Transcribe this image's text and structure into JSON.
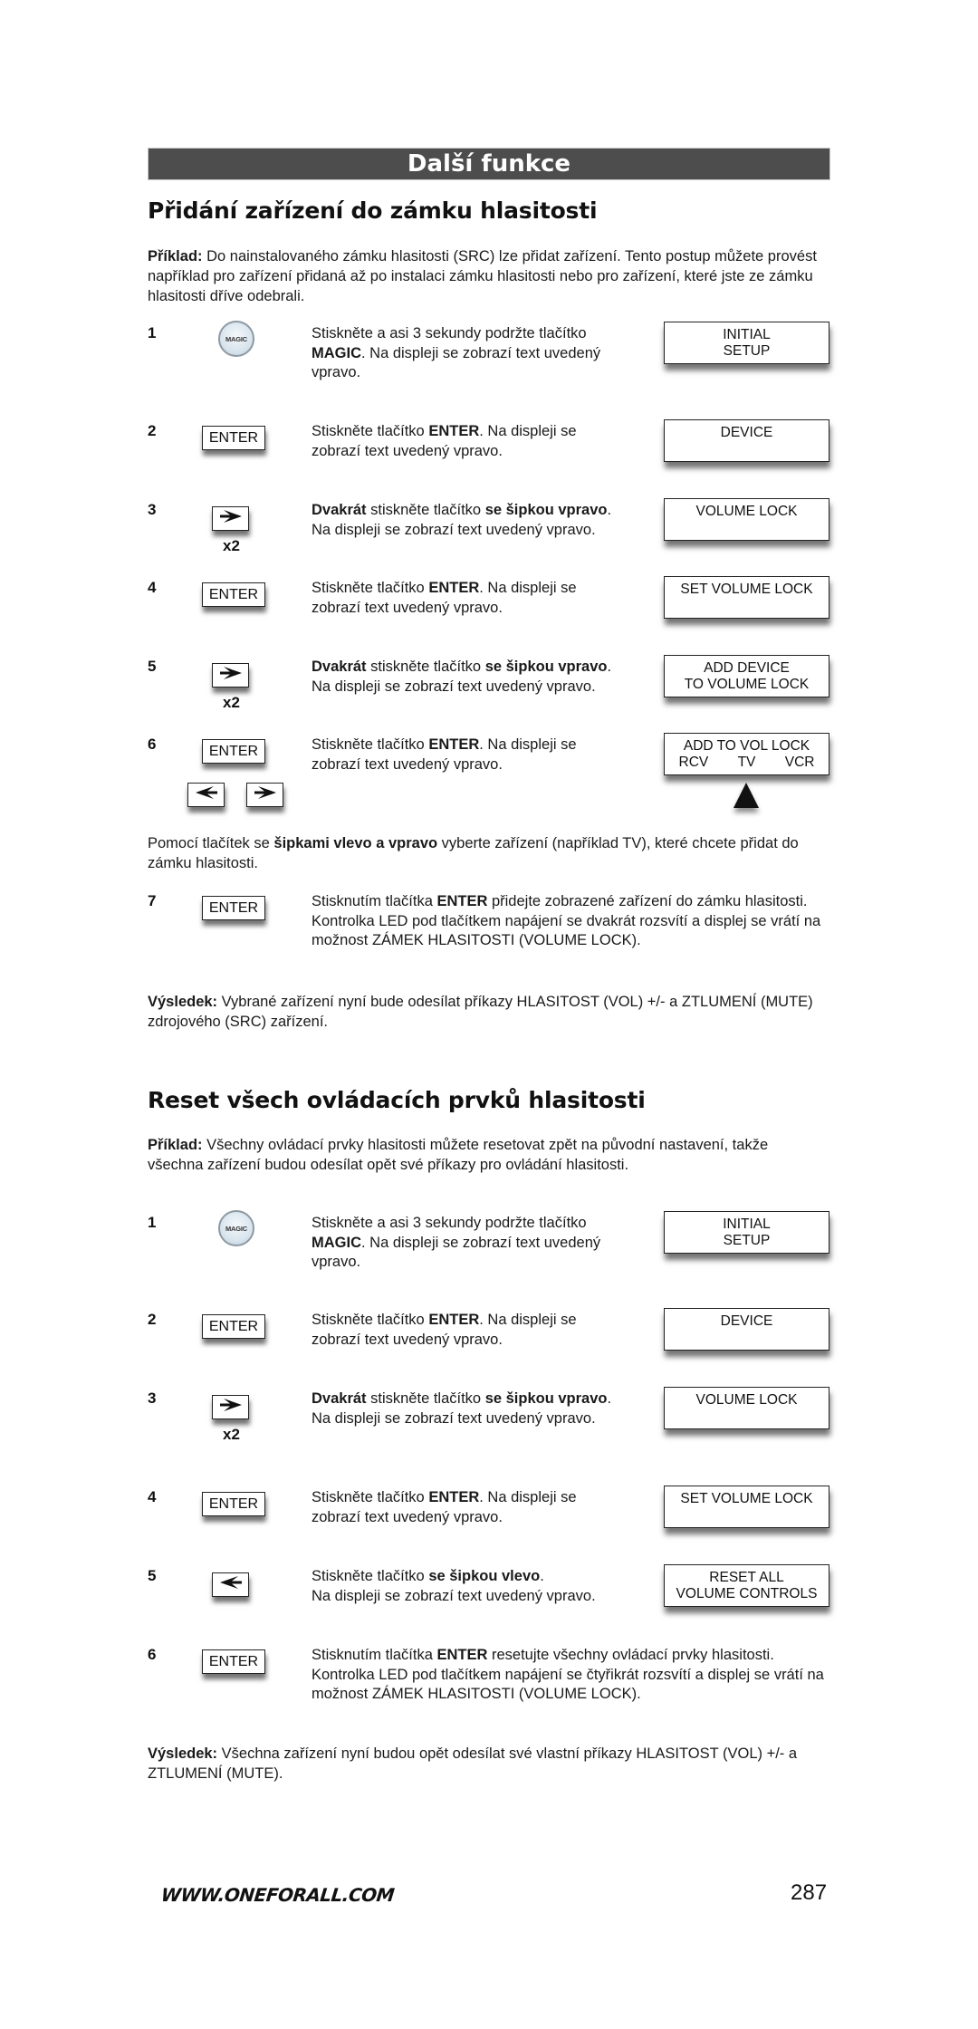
{
  "header": {
    "title": "Další funkce"
  },
  "section1": {
    "title": "Přidání zařízení do zámku hlasitosti",
    "intro_label": "Příklad:",
    "intro_text": " Do nainstalovaného zámku hlasitosti (SRC) lze přidat zařízení. Tento postup můžete provést například pro zařízení přidaná až po instalaci zámku hlasitosti nebo pro zařízení, které jste ze zámku hlasitosti dříve odebrali.",
    "steps": [
      {
        "num": "1",
        "button": "MAGIC",
        "text_parts": [
          [
            "Stiskněte a asi 3 sekundy podržte tlačítko ",
            false
          ],
          [
            "MAGIC",
            true
          ],
          [
            ". Na displeji se zobrazí text uvedený vpravo.",
            false
          ]
        ],
        "display": [
          "INITIAL",
          "SETUP"
        ]
      },
      {
        "num": "2",
        "button": "ENTER",
        "text_parts": [
          [
            "Stiskněte tlačítko ",
            false
          ],
          [
            "ENTER",
            true
          ],
          [
            ". Na displeji se zobrazí text uvedený vpravo.",
            false
          ]
        ],
        "display": [
          "DEVICE"
        ]
      },
      {
        "num": "3",
        "button": "right-arrow",
        "repeat": "x2",
        "text_parts": [
          [
            "Dvakrát",
            true
          ],
          [
            " stiskněte tlačítko ",
            false
          ],
          [
            "se šipkou vpravo",
            true
          ],
          [
            ". Na displeji se zobrazí text uvedený vpravo.",
            false
          ]
        ],
        "display": [
          "VOLUME LOCK"
        ]
      },
      {
        "num": "4",
        "button": "ENTER",
        "text_parts": [
          [
            "Stiskněte tlačítko ",
            false
          ],
          [
            "ENTER",
            true
          ],
          [
            ". Na displeji se zobrazí text uvedený vpravo.",
            false
          ]
        ],
        "display": [
          "SET VOLUME LOCK"
        ]
      },
      {
        "num": "5",
        "button": "right-arrow",
        "repeat": "x2",
        "text_parts": [
          [
            "Dvakrát",
            true
          ],
          [
            " stiskněte tlačítko ",
            false
          ],
          [
            "se šipkou vpravo",
            true
          ],
          [
            ". Na displeji se zobrazí text uvedený vpravo.",
            false
          ]
        ],
        "display": [
          "ADD DEVICE",
          "TO VOLUME LOCK"
        ]
      },
      {
        "num": "6",
        "button": "ENTER",
        "extra_buttons": [
          "left-arrow",
          "right-arrow"
        ],
        "text_parts": [
          [
            "Stiskněte tlačítko ",
            false
          ],
          [
            "ENTER",
            true
          ],
          [
            ". Na displeji se zobrazí text uvedený vpravo.",
            false
          ]
        ],
        "display": [
          "ADD TO VOL LOCK"
        ],
        "display_options": [
          "RCV",
          "TV",
          "VCR"
        ],
        "selected_option": "TV"
      }
    ],
    "select_text_parts": [
      [
        "Pomocí tlačítek se ",
        false
      ],
      [
        "šipkami vlevo a vpravo",
        true
      ],
      [
        " vyberte zařízení (například TV), které chcete přidat do zámku hlasitosti.",
        false
      ]
    ],
    "step7": {
      "num": "7",
      "button": "ENTER",
      "text_parts": [
        [
          "Stisknutím tlačítka ",
          false
        ],
        [
          "ENTER",
          true
        ],
        [
          " přidejte zobrazené zařízení do zámku hlasitosti. Kontrolka LED pod tlačítkem napájení se dvakrát rozsvítí a displej se vrátí na možnost ZÁMEK HLASITOSTI (VOLUME LOCK).",
          false
        ]
      ]
    },
    "result_label": "Výsledek:",
    "result_text": " Vybrané zařízení nyní bude odesílat příkazy HLASITOST (VOL) +/- a ZTLUMENÍ (MUTE) zdrojového (SRC) zařízení."
  },
  "section2": {
    "title": "Reset všech ovládacích prvků hlasitosti",
    "intro_label": "Příklad:",
    "intro_text": " Všechny ovládací prvky hlasitosti můžete resetovat zpět na původní nastavení, takže všechna zařízení budou odesílat opět své příkazy pro ovládání hlasitosti.",
    "steps": [
      {
        "num": "1",
        "button": "MAGIC",
        "text_parts": [
          [
            "Stiskněte a asi 3 sekundy podržte tlačítko ",
            false
          ],
          [
            "MAGIC",
            true
          ],
          [
            ". Na displeji se zobrazí text uvedený vpravo.",
            false
          ]
        ],
        "display": [
          "INITIAL",
          "SETUP"
        ]
      },
      {
        "num": "2",
        "button": "ENTER",
        "text_parts": [
          [
            "Stiskněte tlačítko ",
            false
          ],
          [
            "ENTER",
            true
          ],
          [
            ". Na displeji se zobrazí text uvedený vpravo.",
            false
          ]
        ],
        "display": [
          "DEVICE"
        ]
      },
      {
        "num": "3",
        "button": "right-arrow",
        "repeat": "x2",
        "text_parts": [
          [
            "Dvakrát",
            true
          ],
          [
            " stiskněte tlačítko ",
            false
          ],
          [
            "se šipkou vpravo",
            true
          ],
          [
            ". Na displeji se zobrazí text uvedený vpravo.",
            false
          ]
        ],
        "display": [
          "VOLUME LOCK"
        ]
      },
      {
        "num": "4",
        "button": "ENTER",
        "text_parts": [
          [
            "Stiskněte tlačítko ",
            false
          ],
          [
            "ENTER",
            true
          ],
          [
            ". Na displeji se zobrazí text uvedený vpravo.",
            false
          ]
        ],
        "display": [
          "SET VOLUME LOCK"
        ]
      },
      {
        "num": "5",
        "button": "left-arrow",
        "text_parts": [
          [
            "Stiskněte tlačítko ",
            false
          ],
          [
            "se šipkou vlevo",
            true
          ],
          [
            ".\nNa displeji se zobrazí text uvedený vpravo.",
            false
          ]
        ],
        "display": [
          "RESET ALL",
          "VOLUME CONTROLS"
        ]
      },
      {
        "num": "6",
        "button": "ENTER",
        "text_parts": [
          [
            "Stisknutím tlačítka ",
            false
          ],
          [
            "ENTER",
            true
          ],
          [
            " resetujte všechny ovládací prvky hlasitosti. Kontrolka LED pod tlačítkem napájení se čtyřikrát rozsvítí a displej se vrátí na možnost ZÁMEK HLASITOSTI (VOLUME LOCK).",
            false
          ]
        ]
      }
    ],
    "result_label": "Výsledek:",
    "result_text": " Všechna zařízení nyní budou opět odesílat své vlastní příkazy HLASITOST (VOL) +/- a ZTLUMENÍ (MUTE)."
  },
  "footer": {
    "url": "WWW.ONEFORALL.COM",
    "page_number": "287"
  }
}
